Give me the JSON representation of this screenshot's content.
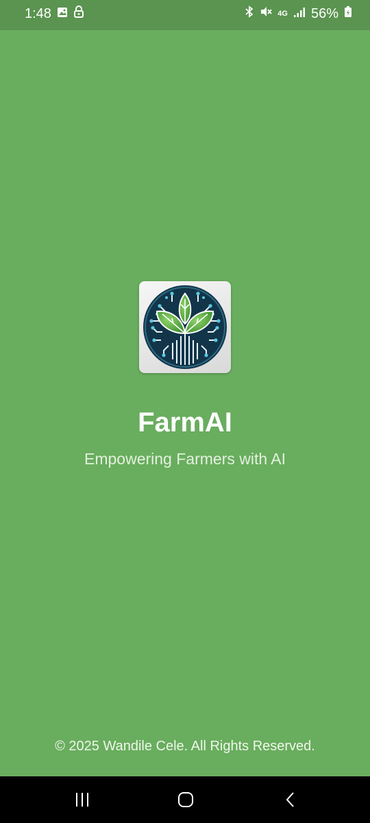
{
  "status_bar": {
    "time": "1:48",
    "network": "4G",
    "battery": "56%",
    "icons": [
      "image-icon",
      "lock-icon",
      "bluetooth-icon",
      "mute-icon",
      "signal-icon",
      "battery-icon"
    ]
  },
  "app": {
    "title": "FarmAI",
    "tagline": "Empowering Farmers with AI",
    "logo": "farmai-logo"
  },
  "footer": {
    "copyright": "© 2025 Wandile Cele. All Rights Reserved."
  },
  "nav": {
    "items": [
      "recent-apps-icon",
      "home-icon",
      "back-icon"
    ]
  },
  "colors": {
    "background": "#69ad5e",
    "status_bar": "#5a9450",
    "nav_bar": "#000000"
  }
}
